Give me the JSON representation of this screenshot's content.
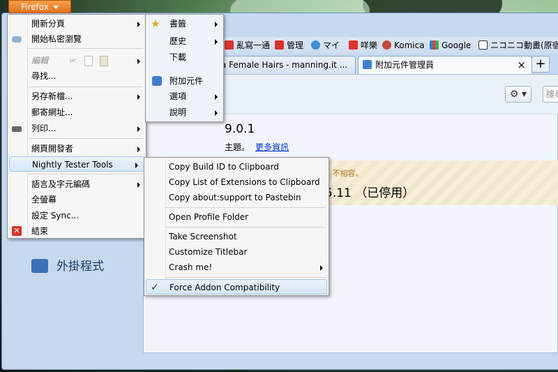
{
  "app": {
    "button_label": "Firefox"
  },
  "bookmarks": [
    {
      "label": "亂寫一通",
      "icon": "red-site-icon"
    },
    {
      "label": "管理",
      "icon": "red-site-icon"
    },
    {
      "label": "マイ",
      "icon": "blue-site-icon"
    },
    {
      "label": "咩樂",
      "icon": "red-site-icon"
    },
    {
      "label": "Komica",
      "icon": "character-icon"
    },
    {
      "label": "Google",
      "icon": "google-icon"
    },
    {
      "label": "ニコニコ動畫(原宿",
      "icon": "tv-icon"
    }
  ],
  "tabs": [
    {
      "label": "a Female Hairs - manning.it ...",
      "close": "×"
    },
    {
      "label": "附加元件管理員",
      "close": "×"
    }
  ],
  "new_tab_label": "+",
  "content": {
    "gear_label": "⚙ ▾",
    "search_placeholder": "搜尋",
    "item1_version": "9.0.1",
    "item1_desc": "主題。",
    "item1_link": "更多資訊",
    "item2_warning": "1 不相容。",
    "item2_name": "5.11 （已停用）",
    "category_plugins": "外掛程式"
  },
  "main_menu": {
    "items": [
      {
        "label": "開新分頁",
        "submenu": true
      },
      {
        "label": "開始私密瀏覽",
        "submenu": false,
        "icon": "mask-icon"
      },
      {
        "label": "編輯",
        "submenu": true,
        "disabled": true
      },
      {
        "label": "尋找...",
        "submenu": false
      },
      {
        "label": "另存新檔...",
        "submenu": true
      },
      {
        "label": "郵寄網址...",
        "submenu": false
      },
      {
        "label": "列印...",
        "submenu": true,
        "icon": "printer-icon"
      },
      {
        "label": "網頁開發者",
        "submenu": true
      },
      {
        "label": "Nightly Tester Tools",
        "submenu": true,
        "highlighted": true
      },
      {
        "label": "語言及字元編碼",
        "submenu": true
      },
      {
        "label": "全螢幕",
        "submenu": false
      },
      {
        "label": "設定 Sync...",
        "submenu": false
      },
      {
        "label": "結束",
        "submenu": false,
        "icon": "exit-icon"
      }
    ]
  },
  "side_menu": {
    "items": [
      {
        "label": "書籤",
        "submenu": true,
        "icon": "star-icon"
      },
      {
        "label": "歷史",
        "submenu": true
      },
      {
        "label": "下載",
        "submenu": false
      },
      {
        "label": "附加元件",
        "submenu": false,
        "icon": "puzzle-icon"
      },
      {
        "label": "選項",
        "submenu": true
      },
      {
        "label": "說明",
        "submenu": true
      }
    ]
  },
  "nightly_menu": {
    "items": [
      {
        "label": "Copy Build ID to Clipboard"
      },
      {
        "label": "Copy List of Extensions to Clipboard"
      },
      {
        "label": "Copy about:support to Pastebin"
      },
      {
        "label": "Open Profile Folder"
      },
      {
        "label": "Take Screenshot"
      },
      {
        "label": "Customize Titlebar"
      },
      {
        "label": "Crash me!",
        "submenu": true
      },
      {
        "label": "Force Addon Compatibility",
        "checked": true
      }
    ],
    "check_mark": "✓"
  },
  "colors": {
    "firefox_orange": "#e5701b",
    "link_blue": "#0033cc",
    "warning_amber": "#b07a13"
  }
}
